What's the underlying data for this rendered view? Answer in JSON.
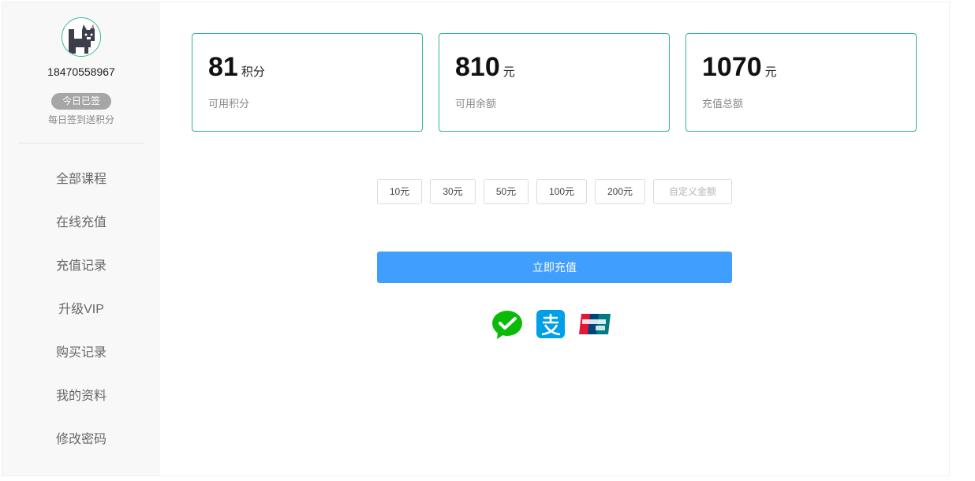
{
  "user": {
    "phone": "18470558967",
    "sign_status": "今日已签",
    "sign_tip": "每日签到送积分"
  },
  "sidebar": {
    "items": [
      {
        "label": "全部课程"
      },
      {
        "label": "在线充值"
      },
      {
        "label": "充值记录"
      },
      {
        "label": "升级VIP"
      },
      {
        "label": "购买记录"
      },
      {
        "label": "我的资料"
      },
      {
        "label": "修改密码"
      }
    ]
  },
  "stats": [
    {
      "value": "81",
      "unit": "积分",
      "label": "可用积分"
    },
    {
      "value": "810",
      "unit": "元",
      "label": "可用余额"
    },
    {
      "value": "1070",
      "unit": "元",
      "label": "充值总额"
    }
  ],
  "amount_options": [
    "10元",
    "30元",
    "50元",
    "100元",
    "200元"
  ],
  "custom_amount_placeholder": "自定义金额",
  "recharge_button": "立即充值",
  "payment_methods": [
    {
      "icon": "wechat-pay-icon",
      "color": "#09bb07"
    },
    {
      "icon": "alipay-icon",
      "color": "#00a0e9"
    },
    {
      "icon": "unionpay-icon",
      "color": "#e21836"
    }
  ],
  "colors": {
    "accent_green": "#2fb887",
    "primary_blue": "#409eff",
    "sidebar_bg": "#f8f8f8"
  }
}
